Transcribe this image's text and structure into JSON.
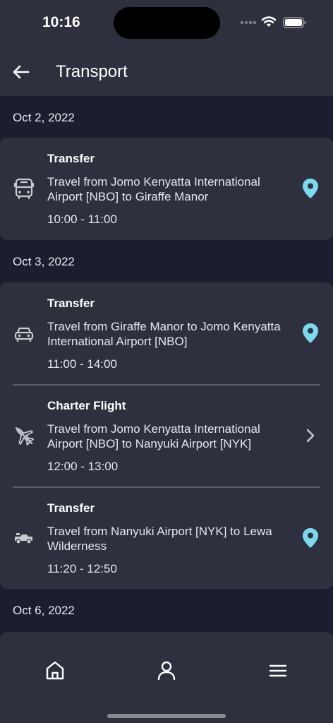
{
  "status": {
    "time": "10:16"
  },
  "header": {
    "title": "Transport"
  },
  "sections": [
    {
      "date": "Oct 2, 2022",
      "items": [
        {
          "type": "Transfer",
          "description": "Travel from Jomo Kenyatta International Airport [NBO] to Giraffe Manor",
          "time": "10:00 - 11:00",
          "icon": "bus-icon",
          "action": "map-pin-icon"
        }
      ]
    },
    {
      "date": "Oct 3, 2022",
      "items": [
        {
          "type": "Transfer",
          "description": "Travel from Giraffe Manor to Jomo Kenyatta International Airport [NBO]",
          "time": "11:00 - 14:00",
          "icon": "car-icon",
          "action": "map-pin-icon"
        },
        {
          "type": "Charter Flight",
          "description": "Travel from Jomo Kenyatta International Airport [NBO] to Nanyuki Airport [NYK]",
          "time": "12:00 - 13:00",
          "icon": "plane-icon",
          "action": "chevron-right-icon"
        },
        {
          "type": "Transfer",
          "description": "Travel from Nanyuki Airport [NYK] to Lewa Wilderness",
          "time": "11:20 - 12:50",
          "icon": "jeep-icon",
          "action": "map-pin-icon"
        }
      ]
    },
    {
      "date": "Oct 6, 2022",
      "items": []
    }
  ],
  "colors": {
    "background": "#1c1d2e",
    "card": "#2e303e",
    "accent": "#7ed9ee"
  },
  "nav": [
    "home-icon",
    "user-icon",
    "menu-icon"
  ]
}
